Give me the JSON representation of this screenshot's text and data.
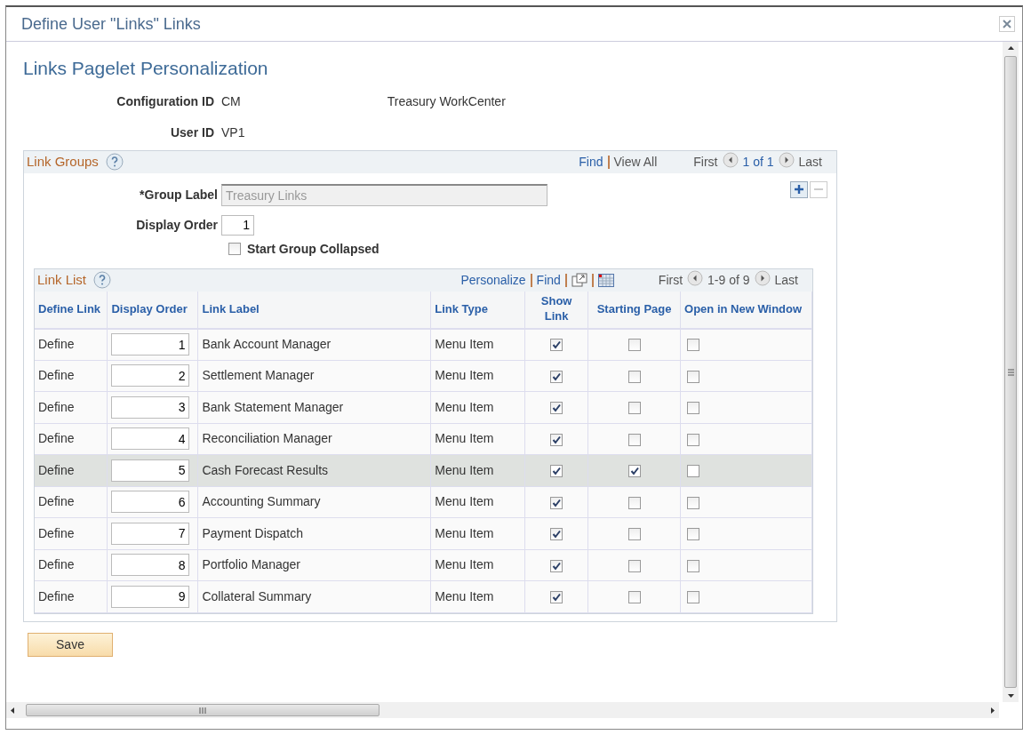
{
  "window": {
    "title": "Define User \"Links\" Links"
  },
  "page_title": "Links Pagelet Personalization",
  "fields": [
    {
      "label": "Configuration ID",
      "value": "CM",
      "description": "Treasury WorkCenter"
    },
    {
      "label": "User ID",
      "value": "VP1"
    }
  ],
  "link_groups": {
    "title": "Link Groups",
    "nav": {
      "find": "Find",
      "view_all": "View All",
      "first": "First",
      "range": "1 of 1",
      "last": "Last"
    },
    "group_label": {
      "label": "*Group Label",
      "value": "Treasury Links",
      "disabled": true
    },
    "display_order": {
      "label": "Display Order",
      "value": "1"
    },
    "start_collapsed": {
      "label": "Start Group Collapsed",
      "checked": false
    },
    "link_list": {
      "title": "Link List",
      "toolbar": {
        "personalize": "Personalize",
        "find": "Find",
        "first": "First",
        "range": "1-9 of 9",
        "last": "Last"
      },
      "columns": [
        "Define Link",
        "Display Order",
        "Link Label",
        "Link Type",
        "Show Link",
        "Starting Page",
        "Open in New Window"
      ],
      "rows": [
        {
          "define": "Define",
          "display_order": "1",
          "link_label": "Bank Account Manager",
          "link_type": "Menu Item",
          "show_link": true,
          "starting_page": false,
          "open_in_new_window": false,
          "selected": false
        },
        {
          "define": "Define",
          "display_order": "2",
          "link_label": "Settlement Manager",
          "link_type": "Menu Item",
          "show_link": true,
          "starting_page": false,
          "open_in_new_window": false,
          "selected": false
        },
        {
          "define": "Define",
          "display_order": "3",
          "link_label": "Bank Statement Manager",
          "link_type": "Menu Item",
          "show_link": true,
          "starting_page": false,
          "open_in_new_window": false,
          "selected": false
        },
        {
          "define": "Define",
          "display_order": "4",
          "link_label": "Reconciliation Manager",
          "link_type": "Menu Item",
          "show_link": true,
          "starting_page": false,
          "open_in_new_window": false,
          "selected": false
        },
        {
          "define": "Define",
          "display_order": "5",
          "link_label": "Cash Forecast Results",
          "link_type": "Menu Item",
          "show_link": true,
          "starting_page": true,
          "open_in_new_window": false,
          "selected": true
        },
        {
          "define": "Define",
          "display_order": "6",
          "link_label": "Accounting Summary",
          "link_type": "Menu Item",
          "show_link": true,
          "starting_page": false,
          "open_in_new_window": false,
          "selected": false
        },
        {
          "define": "Define",
          "display_order": "7",
          "link_label": "Payment Dispatch",
          "link_type": "Menu Item",
          "show_link": true,
          "starting_page": false,
          "open_in_new_window": false,
          "selected": false
        },
        {
          "define": "Define",
          "display_order": "8",
          "link_label": "Portfolio Manager",
          "link_type": "Menu Item",
          "show_link": true,
          "starting_page": false,
          "open_in_new_window": false,
          "selected": false
        },
        {
          "define": "Define",
          "display_order": "9",
          "link_label": "Collateral Summary",
          "link_type": "Menu Item",
          "show_link": true,
          "starting_page": false,
          "open_in_new_window": false,
          "selected": false
        }
      ]
    }
  },
  "save_button": "Save"
}
